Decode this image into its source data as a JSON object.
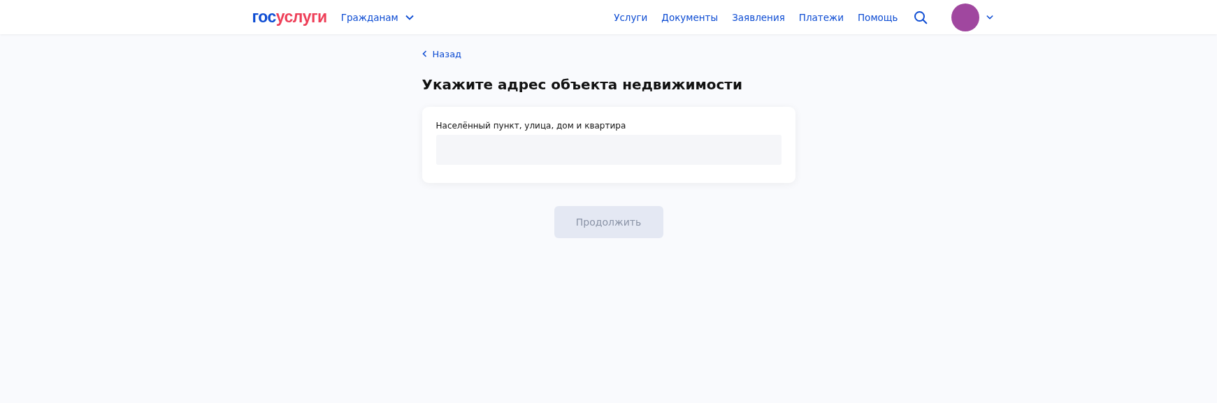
{
  "header": {
    "logo": [
      {
        "text": "гос",
        "color": "#0d4cd3"
      },
      {
        "text": "услуги",
        "color": "#ee3f58"
      }
    ],
    "audience_menu": {
      "label": "Гражданам",
      "expanded": false
    },
    "nav": [
      "Услуги",
      "Документы",
      "Заявления",
      "Платежи",
      "Помощь"
    ]
  },
  "back_link": "Назад",
  "title": "Укажите адрес объекта недвижимости",
  "form": {
    "field": {
      "label": "Населённый пункт, улица, дом и квартира"
    }
  },
  "continue_button": {
    "label": "Продолжить",
    "disabled": true
  }
}
